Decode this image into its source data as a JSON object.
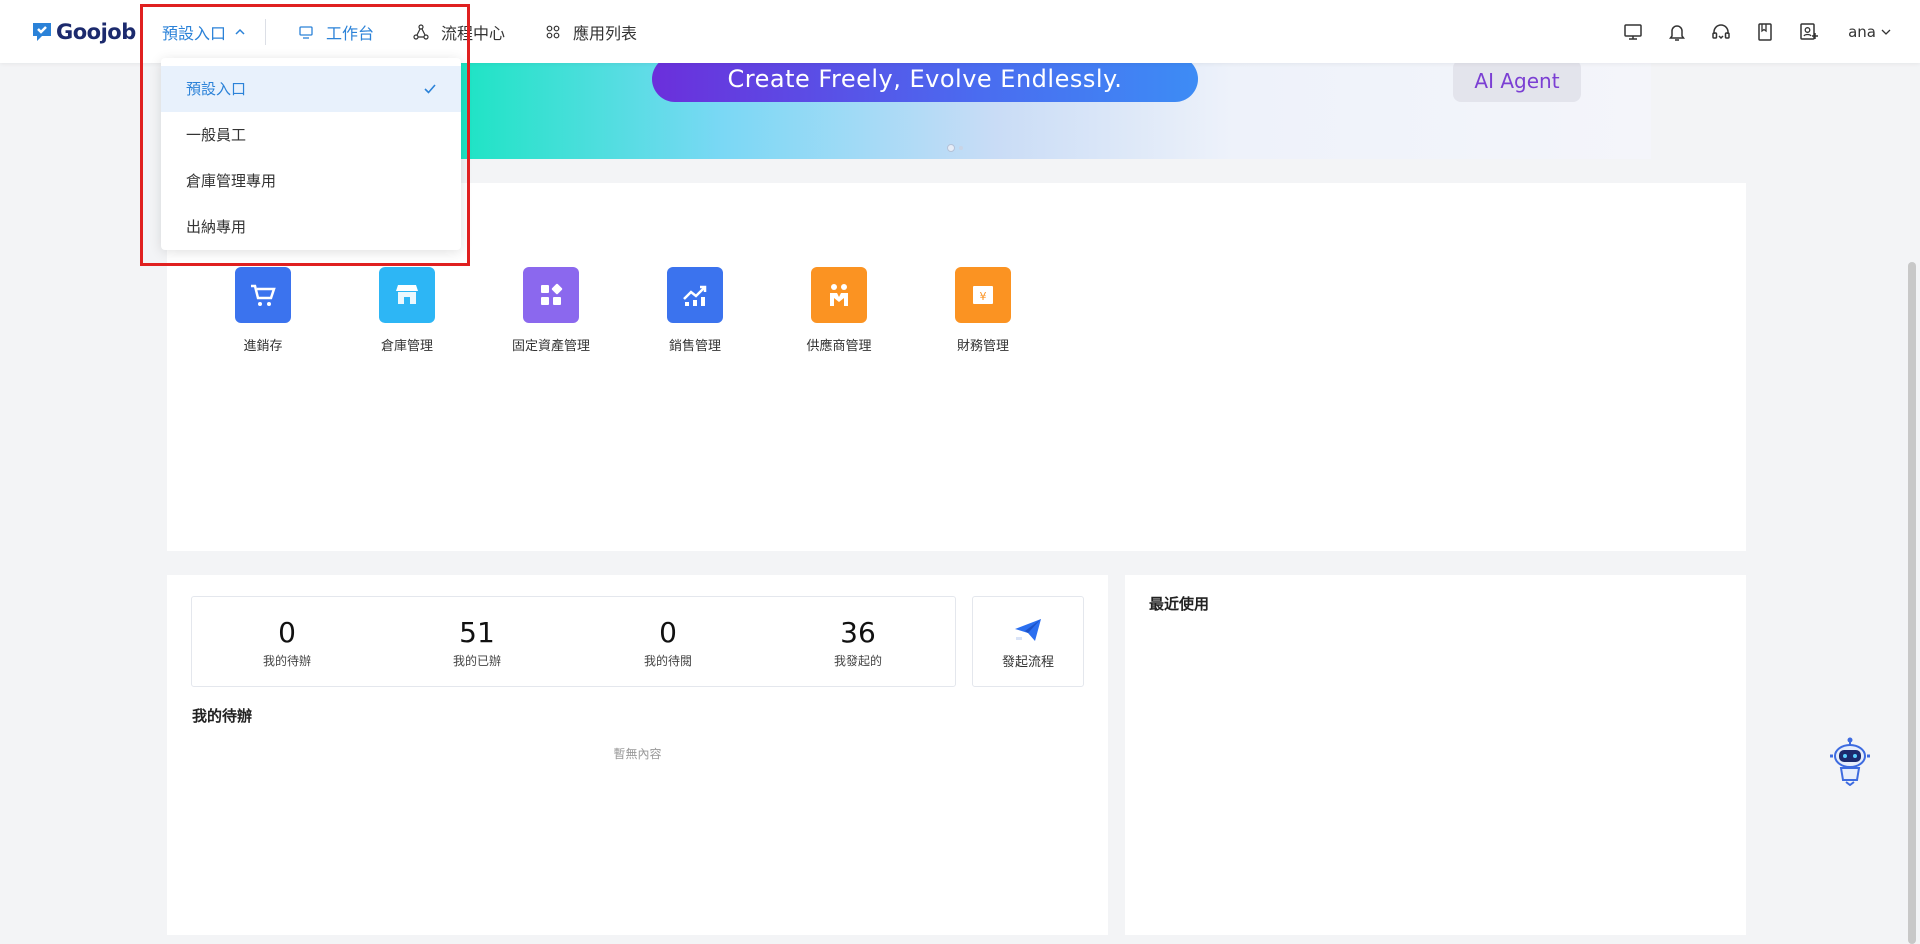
{
  "brand": {
    "name": "Goojob"
  },
  "header": {
    "entry_selector": {
      "label": "預設入口"
    },
    "nav": [
      {
        "label": "工作台",
        "icon": "monitor-icon",
        "active": true
      },
      {
        "label": "流程中心",
        "icon": "workflow-icon",
        "active": false
      },
      {
        "label": "應用列表",
        "icon": "apps-grid-icon",
        "active": false
      }
    ],
    "tools": [
      "desktop-icon",
      "bell-icon",
      "headset-icon",
      "book-icon",
      "contact-icon"
    ],
    "user": {
      "name": "ana"
    }
  },
  "entry_dropdown": {
    "items": [
      {
        "label": "預設入口",
        "selected": true
      },
      {
        "label": "一般員工",
        "selected": false
      },
      {
        "label": "倉庫管理專用",
        "selected": false
      },
      {
        "label": "出納專用",
        "selected": false
      }
    ]
  },
  "banner": {
    "slogan": "Create Freely, Evolve Endlessly.",
    "badge": "AI Agent",
    "slide_count": 2,
    "active_slide": 1
  },
  "apps": [
    {
      "label": "進銷存",
      "icon": "cart-icon",
      "color": "#3b73ee"
    },
    {
      "label": "倉庫管理",
      "icon": "store-icon",
      "color": "#2db6f5"
    },
    {
      "label": "固定資產管理",
      "icon": "blocks-icon",
      "color": "#8b68ee"
    },
    {
      "label": "銷售管理",
      "icon": "growth-chart-icon",
      "color": "#3b73ee"
    },
    {
      "label": "供應商管理",
      "icon": "handshake-icon",
      "color": "#fb9322"
    },
    {
      "label": "財務管理",
      "icon": "yuan-icon",
      "color": "#fb9322"
    }
  ],
  "todo": {
    "stats": [
      {
        "value": "0",
        "label": "我的待辦"
      },
      {
        "value": "51",
        "label": "我的已辦"
      },
      {
        "value": "0",
        "label": "我的待閱"
      },
      {
        "value": "36",
        "label": "我發起的"
      }
    ],
    "launch_label": "發起流程",
    "section_title": "我的待辦",
    "empty_text": "暫無內容"
  },
  "recent": {
    "title": "最近使用"
  }
}
